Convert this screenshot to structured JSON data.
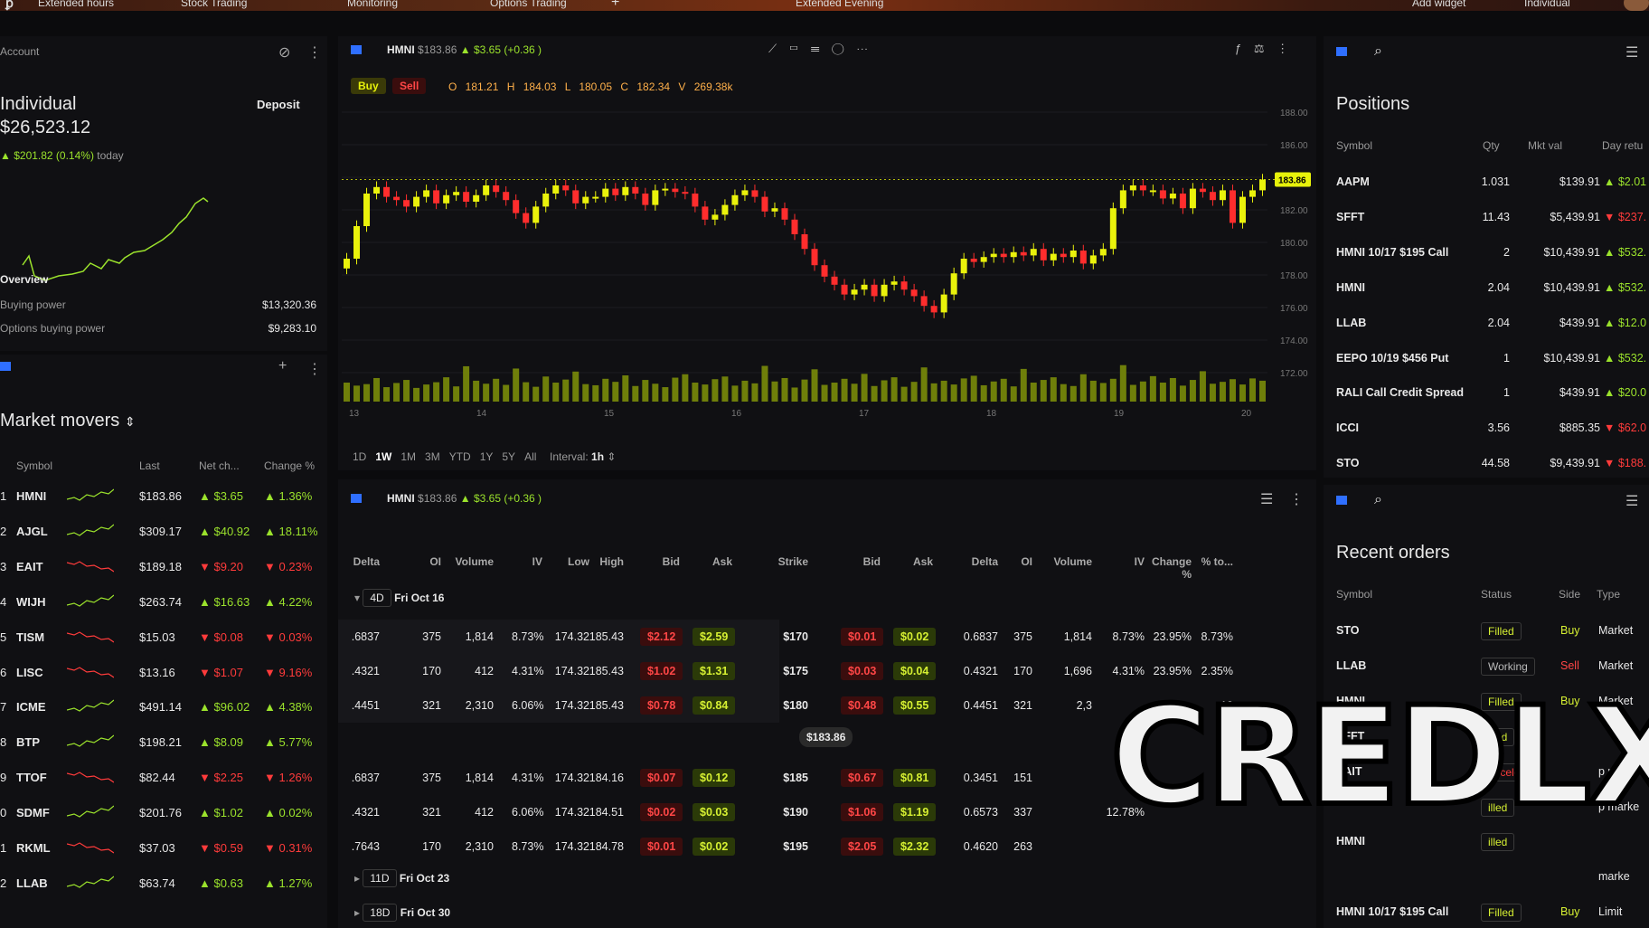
{
  "topbar": {
    "extended": "Extended hours",
    "stock": "Stock Trading",
    "monitoring": "Monitoring",
    "options": "Options Trading",
    "plus": "+",
    "evening": "Extended Evening",
    "add_widget": "Add widget",
    "account": "Individual"
  },
  "account": {
    "label": "Account",
    "name": "Individual",
    "deposit": "Deposit",
    "value": "$26,523.12",
    "change": "$201.82 (0.14%)",
    "today": "today",
    "overview": "Overview",
    "buying_power_label": "Buying power",
    "buying_power": "$13,320.36",
    "options_bp_label": "Options buying power",
    "options_bp": "$9,283.10"
  },
  "movers": {
    "title": "Market movers",
    "cols": [
      "Symbol",
      "Last",
      "Net ch...",
      "Change %"
    ],
    "rows": [
      {
        "n": "1",
        "sym": "HMNI",
        "last": "$183.86",
        "net": "$3.65",
        "pct": "1.36%",
        "up": true
      },
      {
        "n": "2",
        "sym": "AJGL",
        "last": "$309.17",
        "net": "$40.92",
        "pct": "18.11%",
        "up": true
      },
      {
        "n": "3",
        "sym": "EAIT",
        "last": "$189.18",
        "net": "$9.20",
        "pct": "0.23%",
        "up": false
      },
      {
        "n": "4",
        "sym": "WIJH",
        "last": "$263.74",
        "net": "$16.63",
        "pct": "4.22%",
        "up": true
      },
      {
        "n": "5",
        "sym": "TISM",
        "last": "$15.03",
        "net": "$0.08",
        "pct": "0.03%",
        "up": false
      },
      {
        "n": "6",
        "sym": "LISC",
        "last": "$13.16",
        "net": "$1.07",
        "pct": "9.16%",
        "up": false
      },
      {
        "n": "7",
        "sym": "ICME",
        "last": "$491.14",
        "net": "$96.02",
        "pct": "4.38%",
        "up": true
      },
      {
        "n": "8",
        "sym": "BTP",
        "last": "$198.21",
        "net": "$8.09",
        "pct": "5.77%",
        "up": true
      },
      {
        "n": "9",
        "sym": "TTOF",
        "last": "$82.44",
        "net": "$2.25",
        "pct": "1.26%",
        "up": false
      },
      {
        "n": "0",
        "sym": "SDMF",
        "last": "$201.76",
        "net": "$1.02",
        "pct": "0.02%",
        "up": true
      },
      {
        "n": "1",
        "sym": "RKML",
        "last": "$37.03",
        "net": "$0.59",
        "pct": "0.31%",
        "up": false
      },
      {
        "n": "2",
        "sym": "LLAB",
        "last": "$63.74",
        "net": "$0.63",
        "pct": "1.27%",
        "up": true
      }
    ]
  },
  "chart": {
    "symbol": "HMNI",
    "price": "$183.86",
    "change": "$3.65 (+0.36 )",
    "buy": "Buy",
    "sell": "Sell",
    "o": "O 181.21",
    "h": "H 184.03",
    "l": "L 180.05",
    "c": "C 182.34",
    "v": "V 269.38k",
    "last_tag": "183.86",
    "yticks": [
      "188.00",
      "186.00",
      "184.00",
      "182.00",
      "180.00",
      "178.00",
      "176.00",
      "174.00",
      "172.00"
    ],
    "xticks": [
      "13",
      "14",
      "15",
      "16",
      "17",
      "18",
      "19",
      "20"
    ],
    "ranges": [
      "1D",
      "1W",
      "1M",
      "3M",
      "YTD",
      "1Y",
      "5Y",
      "All"
    ],
    "interval_label": "Interval:",
    "interval": "1h"
  },
  "chart_data": {
    "type": "candlestick",
    "x_labels": [
      "13",
      "14",
      "15",
      "16",
      "17",
      "18",
      "19",
      "20"
    ],
    "ylim": [
      172,
      188
    ],
    "close": [
      179,
      181,
      183,
      183.4,
      182.8,
      182.6,
      182.2,
      182.8,
      183.2,
      182.4,
      182.9,
      183.1,
      182.5,
      182.9,
      183.5,
      183.1,
      182.6,
      181.8,
      181.2,
      182.2,
      183,
      183.5,
      183.2,
      182.4,
      182.8,
      182.8,
      183.3,
      182.9,
      183.4,
      183,
      182.3,
      183.2,
      183.3,
      183.1,
      183,
      182.2,
      181.4,
      181.7,
      182.3,
      182.9,
      183.2,
      182.8,
      181.9,
      182.1,
      181.4,
      180.5,
      179.6,
      178.6,
      177.9,
      177.4,
      176.8,
      177.1,
      177.4,
      176.7,
      177.4,
      177.6,
      177.1,
      176.7,
      176.1,
      175.7,
      176.8,
      178.1,
      179,
      178.8,
      179.1,
      179.3,
      179.1,
      179.4,
      179.2,
      179.6,
      178.9,
      179.3,
      179.1,
      179.5,
      178.7,
      179.2,
      179.6,
      182.1,
      183.2,
      183.5,
      183.2,
      183.2,
      182.7,
      183,
      182.1,
      183.3,
      183.1,
      182.6,
      183.2,
      181.2,
      182.8,
      183.2,
      183.86
    ],
    "volume": [
      0.5,
      0.42,
      0.46,
      0.62,
      0.38,
      0.49,
      0.57,
      0.36,
      0.45,
      0.51,
      0.64,
      0.4,
      0.93,
      0.55,
      0.47,
      0.6,
      0.44,
      0.87,
      0.51,
      0.39,
      0.66,
      0.5,
      0.58,
      0.79,
      0.46,
      0.43,
      0.6,
      0.52,
      0.69,
      0.41,
      0.57,
      0.47,
      0.38,
      0.63,
      0.72,
      0.5,
      0.45,
      0.59,
      0.66,
      0.42,
      0.55,
      0.48,
      0.94,
      0.53,
      0.62,
      0.37,
      0.58,
      0.85,
      0.44,
      0.5,
      0.6,
      0.47,
      0.73,
      0.41,
      0.56,
      0.64,
      0.39,
      0.52,
      0.9,
      0.48,
      0.55,
      0.45,
      0.61,
      0.68,
      0.43,
      0.53,
      0.6,
      0.4,
      0.86,
      0.5,
      0.57,
      0.64,
      0.46,
      0.41,
      0.72,
      0.55,
      0.49,
      0.6,
      0.96,
      0.44,
      0.53,
      0.67,
      0.5,
      0.62,
      0.42,
      0.57,
      0.8,
      0.47,
      0.52,
      0.59,
      0.45,
      0.61,
      0.55
    ]
  },
  "options": {
    "symbol": "HMNI",
    "price": "$183.86",
    "change": "$3.65 (+0.36 )",
    "cols": [
      "Delta",
      "OI",
      "Volume",
      "IV",
      "Low",
      "High",
      "Bid",
      "Ask",
      "Strike",
      "Bid",
      "Ask",
      "Delta",
      "OI",
      "Volume",
      "IV",
      "Change %",
      "% to..."
    ],
    "exp1": {
      "days": "4D",
      "date": "Fri",
      "date2": "Oct 16"
    },
    "rows": [
      [
        ".6837",
        "375",
        "1,814",
        "8.73%",
        "174.32",
        "185.43",
        "$2.12",
        "$2.59",
        "$170",
        "$0.01",
        "$0.02",
        "0.6837",
        "375",
        "1,814",
        "8.73%",
        "23.95%",
        "8.73%"
      ],
      [
        ".4321",
        "170",
        "412",
        "4.31%",
        "174.32",
        "185.43",
        "$1.02",
        "$1.31",
        "$175",
        "$0.03",
        "$0.04",
        "0.4321",
        "170",
        "1,696",
        "4.31%",
        "23.95%",
        "2.35%"
      ],
      [
        ".4451",
        "321",
        "2,310",
        "6.06%",
        "174.32",
        "185.43",
        "$0.78",
        "$0.84",
        "$180",
        "$0.48",
        "$0.55",
        "0.4451",
        "321",
        "2,3",
        "",
        "",
        "10"
      ],
      [
        ".6837",
        "375",
        "1,814",
        "4.31%",
        "174.32",
        "184.16",
        "$0.07",
        "$0.12",
        "$185",
        "$0.67",
        "$0.81",
        "0.3451",
        "151",
        "",
        "",
        "",
        ""
      ],
      [
        ".4321",
        "321",
        "412",
        "6.06%",
        "174.32",
        "184.51",
        "$0.02",
        "$0.03",
        "$190",
        "$1.06",
        "$1.19",
        "0.6573",
        "337",
        "",
        "12.78%",
        "",
        ""
      ],
      [
        ".7643",
        "170",
        "2,310",
        "8.73%",
        "174.32",
        "184.78",
        "$0.01",
        "$0.02",
        "$195",
        "$2.05",
        "$2.32",
        "0.4620",
        "263",
        "",
        "",
        "",
        ""
      ]
    ],
    "current": "$183.86",
    "exp2": {
      "days": "11D",
      "date": "Fri",
      "date2": "Oct 23"
    },
    "exp3": {
      "days": "18D",
      "date": "Fri",
      "date2": "Oct 30"
    }
  },
  "positions": {
    "title": "Positions",
    "cols": [
      "Symbol",
      "Qty",
      "Mkt val",
      "Day retu"
    ],
    "rows": [
      {
        "sym": "AAPM",
        "qty": "1.031",
        "val": "$139.91",
        "day": "$2.01",
        "up": true
      },
      {
        "sym": "SFFT",
        "qty": "11.43",
        "val": "$5,439.91",
        "day": "$237.",
        "up": false
      },
      {
        "sym": "HMNI 10/17 $195 Call",
        "qty": "2",
        "val": "$10,439.91",
        "day": "$532.",
        "up": true
      },
      {
        "sym": "HMNI",
        "qty": "2.04",
        "val": "$10,439.91",
        "day": "$532.",
        "up": true
      },
      {
        "sym": "LLAB",
        "qty": "2.04",
        "val": "$439.91",
        "day": "$12.0",
        "up": true
      },
      {
        "sym": "EEPO 10/19 $456 Put",
        "qty": "1",
        "val": "$10,439.91",
        "day": "$532.",
        "up": true
      },
      {
        "sym": "RALI Call Credit Spread",
        "qty": "1",
        "val": "$439.91",
        "day": "$20.0",
        "up": true
      },
      {
        "sym": "ICCI",
        "qty": "3.56",
        "val": "$885.35",
        "day": "$62.0",
        "up": false
      },
      {
        "sym": "STO",
        "qty": "44.58",
        "val": "$9,439.91",
        "day": "$188.",
        "up": false
      }
    ]
  },
  "orders": {
    "title": "Recent orders",
    "cols": [
      "Symbol",
      "Status",
      "Side",
      "Type"
    ],
    "rows": [
      {
        "sym": "STO",
        "status": "Filled",
        "side": "Buy",
        "type": "Market"
      },
      {
        "sym": "LLAB",
        "status": "Working",
        "side": "Sell",
        "type": "Market"
      },
      {
        "sym": "HMNI",
        "status": "Filled",
        "side": "Buy",
        "type": "Market"
      },
      {
        "sym": "SFFT",
        "status": "illed",
        "side": "",
        "type": ""
      },
      {
        "sym": "EAIT",
        "status": "anceled",
        "side": "",
        "type": "p marke"
      },
      {
        "sym": "",
        "status": "illed",
        "side": "",
        "type": "p marke"
      },
      {
        "sym": "HMNI",
        "status": "illed",
        "side": "",
        "type": ""
      },
      {
        "sym": "",
        "status": "",
        "side": "",
        "type": "marke"
      },
      {
        "sym": "HMNI 10/17 $195 Call",
        "status": "Filled",
        "side": "Buy",
        "type": "Limit"
      }
    ]
  },
  "watermark": "CREDLX",
  "colors": {
    "up": "#9be22c",
    "down": "#ff3b3b",
    "candle_up": "#eaf20b",
    "candle_down": "#ff2d2d",
    "volume": "#6f7f0a"
  }
}
